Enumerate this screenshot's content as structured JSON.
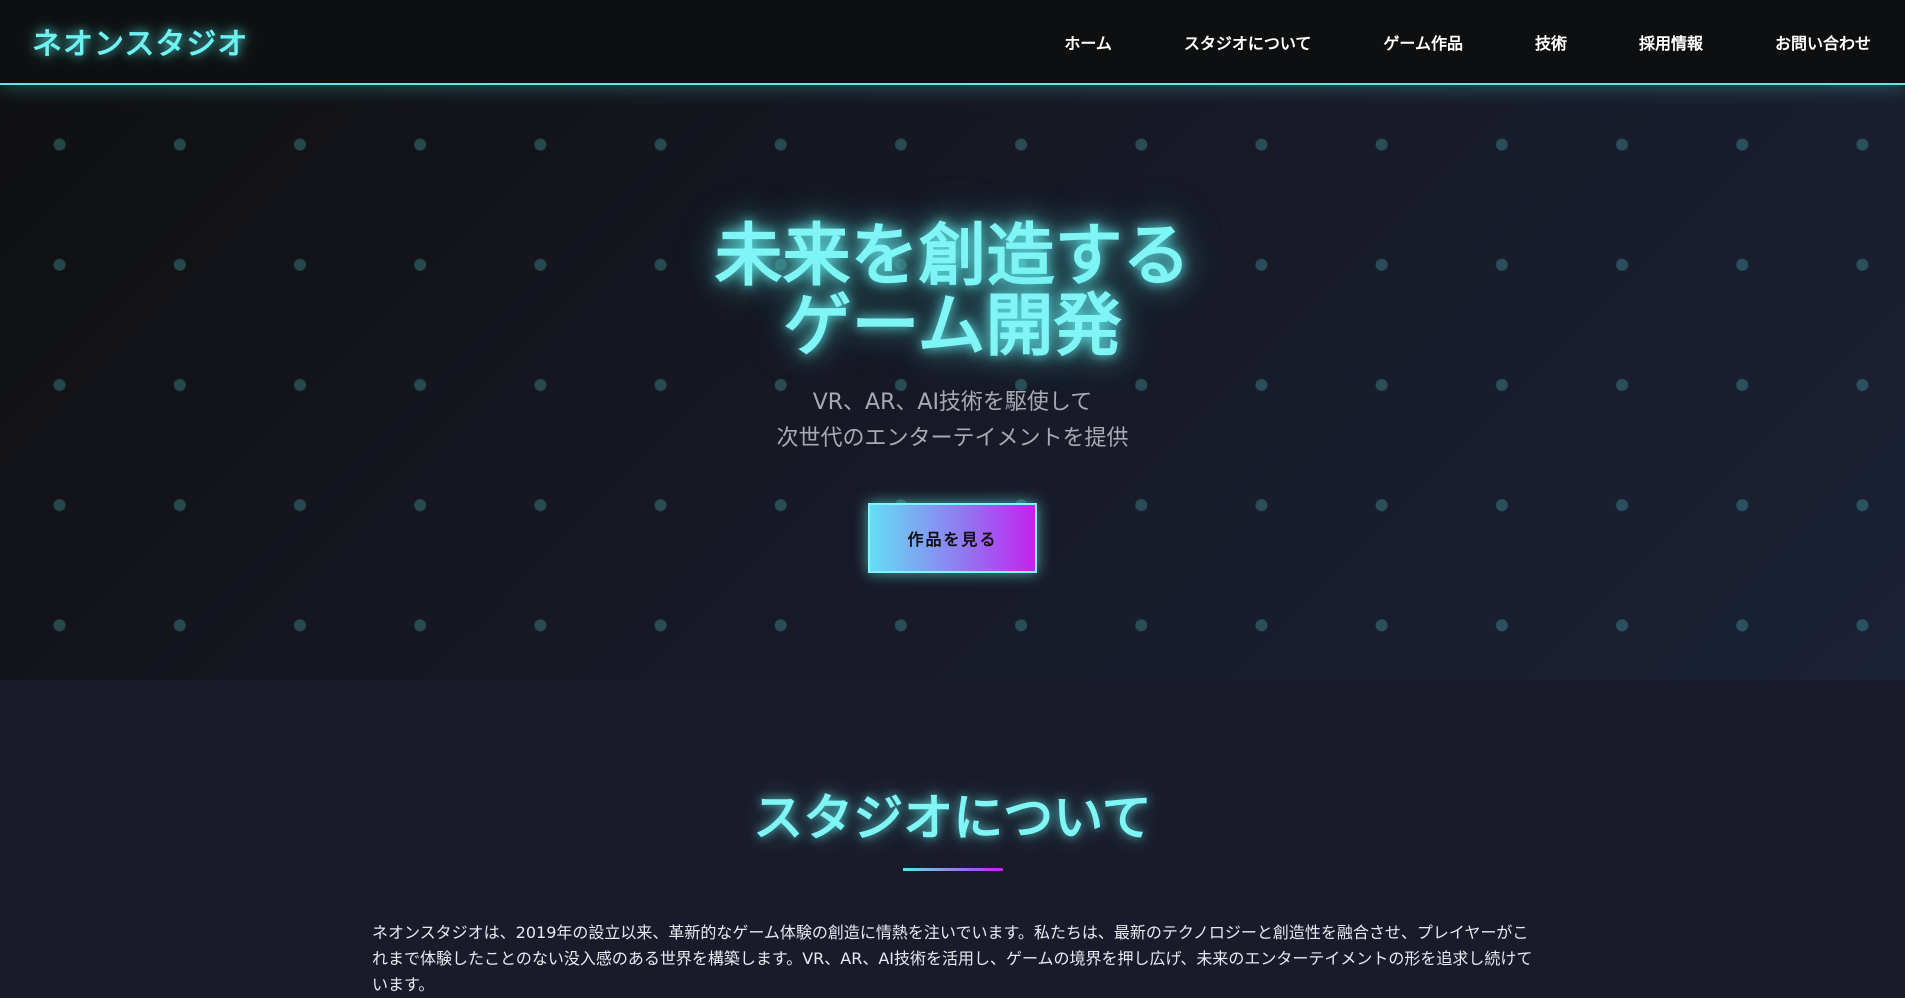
{
  "header": {
    "logo": "ネオンスタジオ",
    "nav": [
      {
        "label": "ホーム"
      },
      {
        "label": "スタジオについて"
      },
      {
        "label": "ゲーム作品"
      },
      {
        "label": "技術"
      },
      {
        "label": "採用情報"
      },
      {
        "label": "お問い合わせ"
      }
    ]
  },
  "hero": {
    "title_line1": "未来を創造する",
    "title_line2": "ゲーム開発",
    "subtitle_line1": "VR、AR、AI技術を駆使して",
    "subtitle_line2": "次世代のエンターテイメントを提供",
    "cta_label": "作品を見る"
  },
  "about": {
    "title": "スタジオについて",
    "text": "ネオンスタジオは、2019年の設立以来、革新的なゲーム体験の創造に情熱を注いでいます。私たちは、最新のテクノロジーと創造性を融合させ、プレイヤーがこれまで体験したことのない没入感のある世界を構築します。VR、AR、AI技術を活用し、ゲームの境界を押し広げ、未来のエンターテイメントの形を追求し続けています。"
  },
  "colors": {
    "accent": "#5ee7e7",
    "accent_text": "#7ff5f5",
    "header_bg": "#0e0f10",
    "page_bg": "#1a1b2a",
    "cta_gradient_start": "#66ddf5",
    "cta_gradient_end": "#c322f0"
  }
}
